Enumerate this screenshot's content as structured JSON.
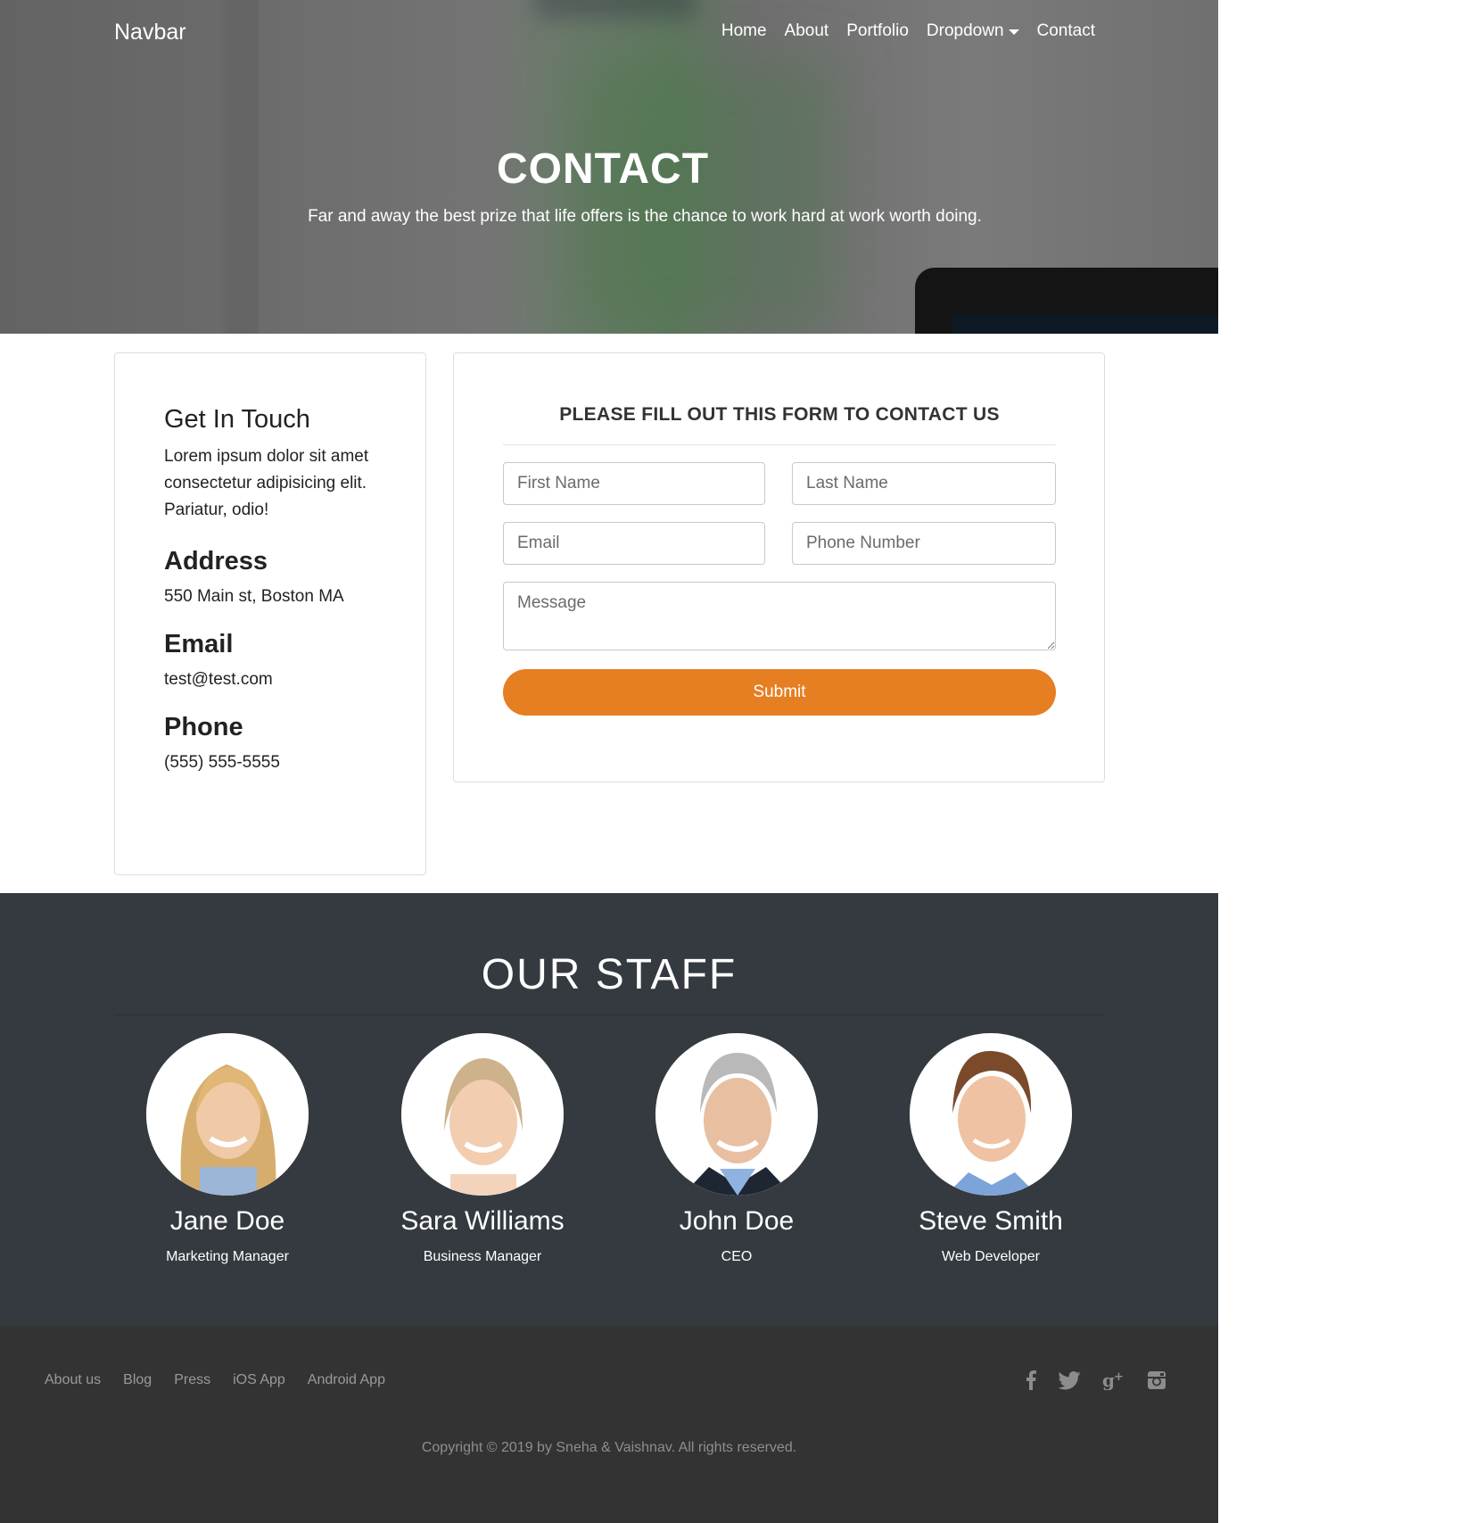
{
  "navbar": {
    "brand": "Navbar",
    "links": [
      "Home",
      "About",
      "Portfolio",
      "Dropdown",
      "Contact"
    ]
  },
  "hero": {
    "title": "CONTACT",
    "subtitle": "Far and away the best prize that life offers is the chance to work hard at work worth doing."
  },
  "contact_info": {
    "heading": "Get In Touch",
    "text": "Lorem ipsum dolor sit amet consectetur adipisicing elit. Pariatur, odio!",
    "address_heading": "Address",
    "address": "550 Main st, Boston MA",
    "email_heading": "Email",
    "email": "test@test.com",
    "phone_heading": "Phone",
    "phone": "(555) 555-5555"
  },
  "form": {
    "title": "PLEASE FILL OUT THIS FORM TO CONTACT US",
    "first_name_placeholder": "First Name",
    "last_name_placeholder": "Last Name",
    "email_placeholder": "Email",
    "phone_placeholder": "Phone Number",
    "message_placeholder": "Message",
    "submit_label": "Submit",
    "submit_color": "#e67e22"
  },
  "staff": {
    "title": "OUR STAFF",
    "members": [
      {
        "name": "Jane Doe",
        "role": "Marketing Manager"
      },
      {
        "name": "Sara Williams",
        "role": "Business Manager"
      },
      {
        "name": "John Doe",
        "role": "CEO"
      },
      {
        "name": "Steve Smith",
        "role": "Web Developer"
      }
    ]
  },
  "footer": {
    "links": [
      "About us",
      "Blog",
      "Press",
      "iOS App",
      "Android App"
    ],
    "social_icons": [
      "facebook-icon",
      "twitter-icon",
      "google-plus-icon",
      "instagram-icon"
    ],
    "copyright": "Copyright © 2019 by Sneha & Vaishnav. All rights reserved."
  },
  "colors": {
    "staff_bg": "#343a40",
    "footer_bg": "#333333",
    "accent": "#e67e22"
  }
}
